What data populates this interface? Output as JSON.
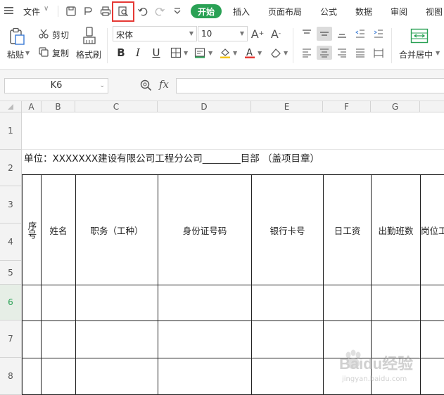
{
  "menubar": {
    "file_label": "文件",
    "tabs": [
      "开始",
      "插入",
      "页面布局",
      "公式",
      "数据",
      "审阅",
      "视图"
    ],
    "active_tab": "开始"
  },
  "ribbon": {
    "paste_label": "粘贴",
    "cut_label": "剪切",
    "copy_label": "复制",
    "format_painter_label": "格式刷",
    "font_name": "宋体",
    "font_size": "10",
    "merge_center_label": "合并居中"
  },
  "formula_bar": {
    "name_box": "K6",
    "fx_label": "fx",
    "formula": ""
  },
  "sheet": {
    "columns": [
      "A",
      "B",
      "C",
      "D",
      "E",
      "F",
      "G"
    ],
    "rows": [
      "1",
      "2",
      "3",
      "4",
      "5",
      "6",
      "7",
      "8"
    ],
    "active_row": "6",
    "row2_text": "单位：XXXXXXX建设有限公司工程分公司________目部  （盖项目章）",
    "headers": {
      "a": "序号",
      "b": "姓名",
      "c": "职务（工种）",
      "d": "身份证号码",
      "e": "银行卡号",
      "f": "日工资",
      "g": "出勤班数",
      "h": "岗位工"
    }
  },
  "watermark": {
    "brand": "Baidu经验",
    "url": "jingyan.baidu.com"
  },
  "colors": {
    "accent_green": "#2aa155",
    "highlight_red": "#e53935"
  }
}
